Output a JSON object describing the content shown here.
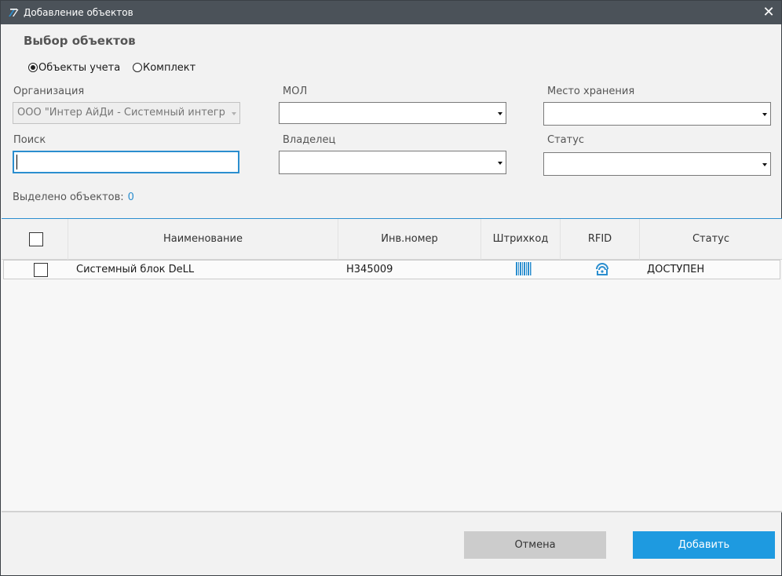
{
  "window": {
    "title": "Добавление объектов",
    "close_glyph": "✕",
    "icon": "app-logo-icon"
  },
  "heading": "Выбор объектов",
  "mode": {
    "options": [
      {
        "label": "Объекты учета",
        "checked": true
      },
      {
        "label": "Комплект",
        "checked": false
      }
    ]
  },
  "filters": {
    "organization": {
      "label": "Организация",
      "value": "ООО \"Интер АйДи - Системный интеграт",
      "disabled": true
    },
    "mol": {
      "label": "МОЛ",
      "value": ""
    },
    "storage": {
      "label": "Место хранения",
      "value": ""
    },
    "search": {
      "label": "Поиск",
      "value": ""
    },
    "owner": {
      "label": "Владелец",
      "value": ""
    },
    "status": {
      "label": "Статус",
      "value": ""
    }
  },
  "selection": {
    "label": "Выделено объектов:",
    "count": "0"
  },
  "table": {
    "columns": [
      "Наименование",
      "Инв.номер",
      "Штрихкод",
      "RFID",
      "Статус"
    ],
    "rows": [
      {
        "name": "Системный блок DeLL",
        "inv": "Н345009",
        "barcode_icon": "barcode-icon",
        "rfid_icon": "rfid-icon",
        "status": "ДОСТУПЕН",
        "checked": false
      }
    ]
  },
  "buttons": {
    "cancel": "Отмена",
    "add": "Добавить"
  },
  "colors": {
    "accent": "#1e9ae0",
    "titlebar": "#4b5259",
    "link": "#2b8ecf"
  }
}
